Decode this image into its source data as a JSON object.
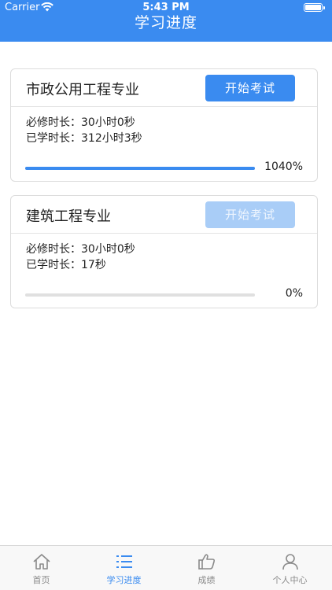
{
  "status_bar": {
    "carrier": "Carrier",
    "time": "5:43 PM"
  },
  "header": {
    "title": "学习进度"
  },
  "courses": [
    {
      "title": "市政公用工程专业",
      "button": "开始考试",
      "button_enabled": true,
      "required_label": "必修时长：",
      "required_value": "30小时0秒",
      "studied_label": "已学时长：",
      "studied_value": "312小时3秒",
      "progress_percent": "1040%",
      "progress_fill": 1.0
    },
    {
      "title": "建筑工程专业",
      "button": "开始考试",
      "button_enabled": false,
      "required_label": "必修时长：",
      "required_value": "30小时0秒",
      "studied_label": "已学时长：",
      "studied_value": "17秒",
      "progress_percent": "0%",
      "progress_fill": 0.0
    }
  ],
  "colors": {
    "primary": "#3a8bf0",
    "primary_disabled": "#a9cdf7",
    "active_tab": "#3a8bf0",
    "inactive_tab": "#8a8a8a"
  },
  "tabbar": {
    "items": [
      {
        "label": "首页",
        "icon": "home-icon",
        "active": false
      },
      {
        "label": "学习进度",
        "icon": "list-icon",
        "active": true
      },
      {
        "label": "成绩",
        "icon": "thumbs-up-icon",
        "active": false
      },
      {
        "label": "个人中心",
        "icon": "user-icon",
        "active": false
      }
    ]
  }
}
